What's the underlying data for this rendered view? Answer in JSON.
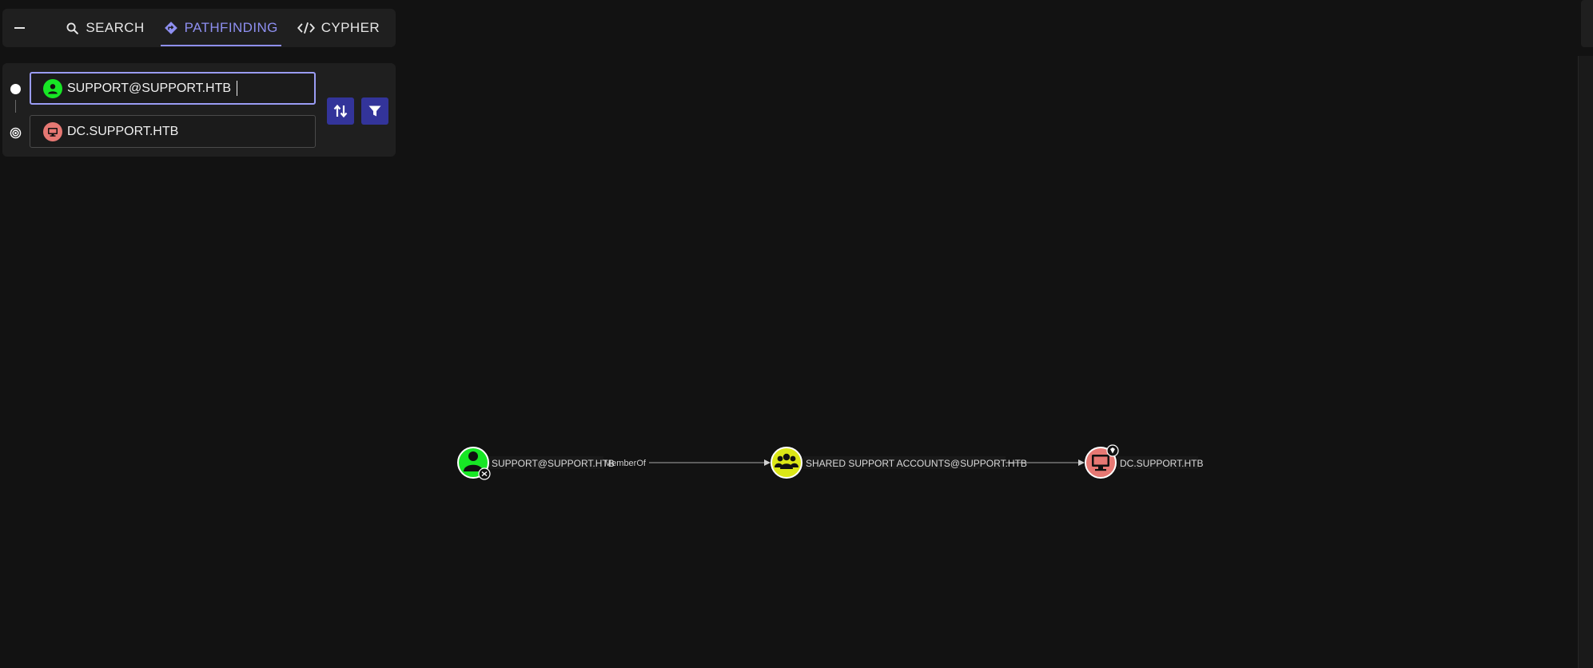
{
  "tabs": {
    "collapse_label": "",
    "items": [
      {
        "label": "SEARCH",
        "icon": "search-icon"
      },
      {
        "label": "PATHFINDING",
        "icon": "pathfinding-icon",
        "active": true
      },
      {
        "label": "CYPHER",
        "icon": "code-icon"
      }
    ]
  },
  "pathfinding": {
    "start": {
      "value": "SUPPORT@SUPPORT.HTB",
      "icon": "user-icon",
      "color": "#17e625"
    },
    "destination": {
      "value": "DC.SUPPORT.HTB",
      "icon": "computer-icon",
      "color": "#e67873"
    },
    "swap_icon": "swap-icon",
    "filter_icon": "filter-icon"
  },
  "graph": {
    "nodes": [
      {
        "label": "SUPPORT@SUPPORT.HTB",
        "type": "User",
        "color": "#17e625",
        "icon": "user-icon"
      },
      {
        "label": "SHARED SUPPORT ACCOUNTS@SUPPORT.HTB",
        "type": "Group",
        "color": "#dbe617",
        "icon": "group-icon"
      },
      {
        "label": "DC.SUPPORT.HTB",
        "type": "Computer",
        "color": "#e67873",
        "icon": "computer-icon"
      }
    ],
    "edges": [
      {
        "label": "MemberOf"
      },
      {
        "label": ""
      }
    ]
  },
  "colors": {
    "accent": "#8e8ff0",
    "button": "#33349a",
    "background": "#121212",
    "panel": "#1f1f1f"
  }
}
